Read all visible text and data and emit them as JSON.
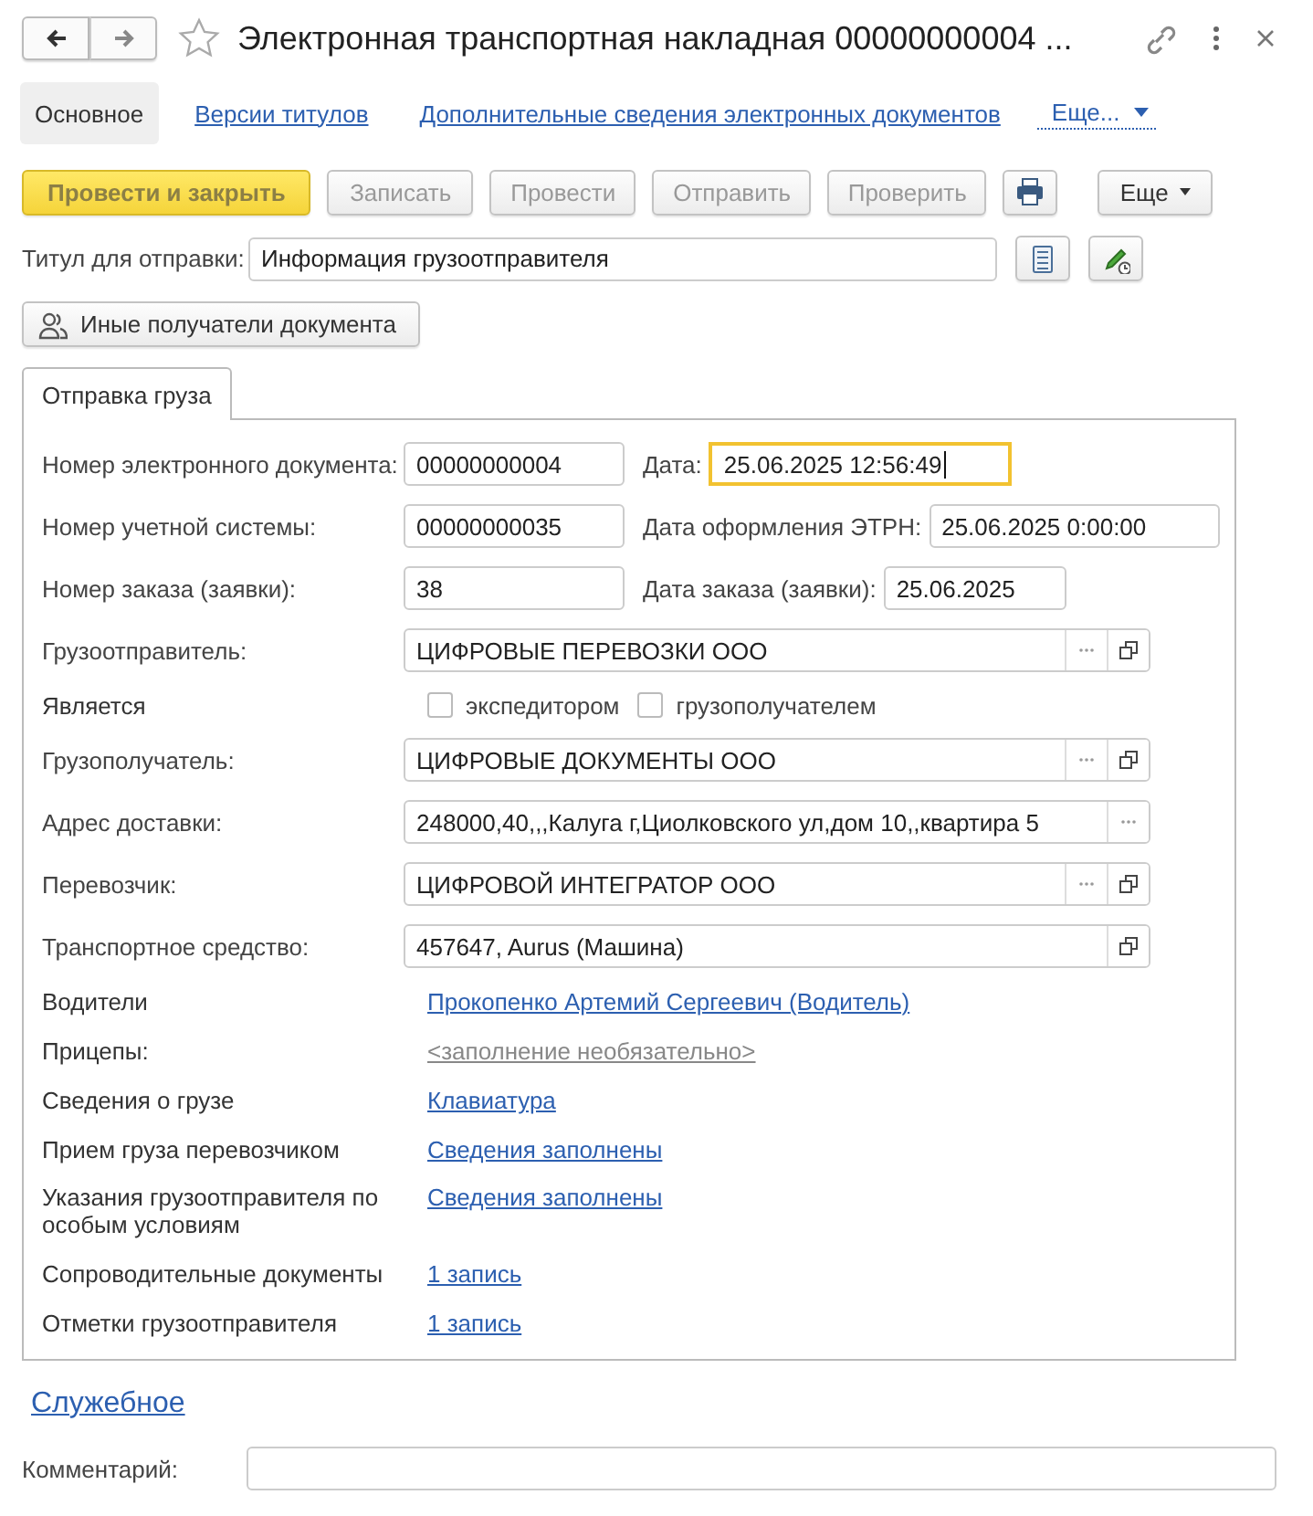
{
  "window": {
    "title": "Электронная транспортная накладная 00000000004 ...",
    "bookmarked": false
  },
  "nav": {
    "items": [
      {
        "label": "Основное",
        "selected": true
      },
      {
        "label": "Версии титулов",
        "selected": false
      },
      {
        "label": "Дополнительные сведения электронных документов",
        "selected": false
      }
    ],
    "more": "Еще..."
  },
  "commands": [
    {
      "kind": "primary",
      "label": "Провести и закрыть",
      "disabled": true
    },
    {
      "kind": "button",
      "label": "Записать",
      "disabled": true
    },
    {
      "kind": "button",
      "label": "Провести",
      "disabled": true
    },
    {
      "kind": "button",
      "label": "Отправить",
      "disabled": true
    },
    {
      "kind": "button",
      "label": "Проверить",
      "disabled": true
    },
    {
      "kind": "print",
      "disabled": false
    },
    {
      "kind": "menu",
      "label": "Еще",
      "disabled": false
    }
  ],
  "title_field": {
    "label": "Титул для отправки:",
    "value": "Информация грузоотправителя"
  },
  "recipients_button": "Иные получатели документа",
  "tabs": [
    {
      "label": "Отправка груза",
      "selected": true
    }
  ],
  "rows": [
    {
      "kind": "pair",
      "label": "Номер электронного документа:",
      "value": "00000000004",
      "focused": false,
      "second": {
        "label": "Дата:",
        "value": "25.06.2025 12:56:49",
        "focused": true
      }
    },
    {
      "kind": "pair",
      "label": "Номер учетной системы:",
      "value": "00000000035",
      "focused": false,
      "second": {
        "label": "Дата оформления ЭТРН:",
        "value": "25.06.2025  0:00:00",
        "focused": false
      }
    },
    {
      "kind": "pair",
      "label": "Номер заказа (заявки):",
      "value": "38",
      "focused": false,
      "second": {
        "label": "Дата заказа (заявки):",
        "value": "25.06.2025",
        "focused": false
      }
    },
    {
      "kind": "ref",
      "label": "Грузоотправитель:",
      "value": "ЦИФРОВЫЕ ПЕРЕВОЗКИ ООО",
      "has_select": true,
      "has_open": true
    },
    {
      "kind": "checks",
      "label": "Является",
      "options": [
        {
          "label": "экспедитором",
          "checked": false
        },
        {
          "label": "грузополучателем",
          "checked": false
        }
      ]
    },
    {
      "kind": "ref",
      "label": "Грузополучатель:",
      "value": "ЦИФРОВЫЕ ДОКУМЕНТЫ ООО",
      "has_select": true,
      "has_open": true
    },
    {
      "kind": "ref",
      "label": "Адрес доставки:",
      "value": "248000,40,,,Калуга г,Циолковского ул,дом 10,,квартира 5",
      "has_select": true,
      "has_open": false
    },
    {
      "kind": "ref",
      "label": "Перевозчик:",
      "value": "ЦИФРОВОЙ ИНТЕГРАТОР ООО",
      "has_select": true,
      "has_open": true
    },
    {
      "kind": "ref",
      "label": "Транспортное средство:",
      "value": "457647, Aurus (Машина)",
      "has_select": false,
      "has_open": true
    },
    {
      "kind": "link",
      "label": "Водители",
      "value": "Прокопенко Артемий Сергеевич (Водитель)",
      "empty": false
    },
    {
      "kind": "link",
      "label": "Прицепы:",
      "value": "<заполнение необязательно>",
      "empty": true
    },
    {
      "kind": "link",
      "label": "Сведения о грузе",
      "value": "Клавиатура",
      "empty": false
    },
    {
      "kind": "link",
      "label": "Прием груза перевозчиком",
      "value": "Сведения заполнены",
      "empty": false
    },
    {
      "kind": "link",
      "label": "Указания грузоотправителя по особым условиям",
      "value": "Сведения заполнены",
      "empty": false
    },
    {
      "kind": "link",
      "label": "Сопроводительные документы",
      "value": "1 запись",
      "empty": false
    },
    {
      "kind": "link",
      "label": "Отметки грузоотправителя",
      "value": "1 запись",
      "empty": false
    }
  ],
  "service_link": "Служебное",
  "comment": {
    "label": "Комментарий:"
  }
}
